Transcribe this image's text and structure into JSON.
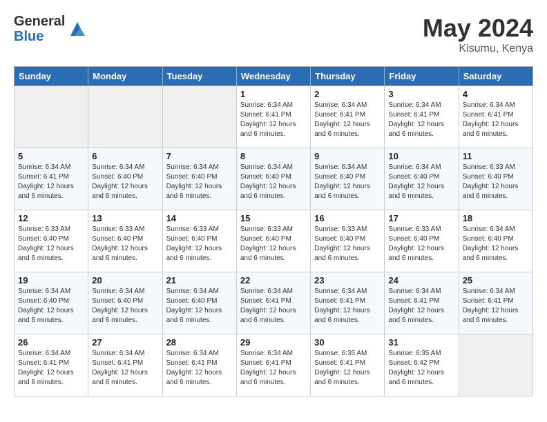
{
  "header": {
    "logo_general": "General",
    "logo_blue": "Blue",
    "month_title": "May 2024",
    "location": "Kisumu, Kenya"
  },
  "days_of_week": [
    "Sunday",
    "Monday",
    "Tuesday",
    "Wednesday",
    "Thursday",
    "Friday",
    "Saturday"
  ],
  "weeks": [
    [
      {
        "day": "",
        "info": ""
      },
      {
        "day": "",
        "info": ""
      },
      {
        "day": "",
        "info": ""
      },
      {
        "day": "1",
        "info": "Sunrise: 6:34 AM\nSunset: 6:41 PM\nDaylight: 12 hours\nand 6 minutes."
      },
      {
        "day": "2",
        "info": "Sunrise: 6:34 AM\nSunset: 6:41 PM\nDaylight: 12 hours\nand 6 minutes."
      },
      {
        "day": "3",
        "info": "Sunrise: 6:34 AM\nSunset: 6:41 PM\nDaylight: 12 hours\nand 6 minutes."
      },
      {
        "day": "4",
        "info": "Sunrise: 6:34 AM\nSunset: 6:41 PM\nDaylight: 12 hours\nand 6 minutes."
      }
    ],
    [
      {
        "day": "5",
        "info": "Sunrise: 6:34 AM\nSunset: 6:41 PM\nDaylight: 12 hours\nand 6 minutes."
      },
      {
        "day": "6",
        "info": "Sunrise: 6:34 AM\nSunset: 6:40 PM\nDaylight: 12 hours\nand 6 minutes."
      },
      {
        "day": "7",
        "info": "Sunrise: 6:34 AM\nSunset: 6:40 PM\nDaylight: 12 hours\nand 6 minutes."
      },
      {
        "day": "8",
        "info": "Sunrise: 6:34 AM\nSunset: 6:40 PM\nDaylight: 12 hours\nand 6 minutes."
      },
      {
        "day": "9",
        "info": "Sunrise: 6:34 AM\nSunset: 6:40 PM\nDaylight: 12 hours\nand 6 minutes."
      },
      {
        "day": "10",
        "info": "Sunrise: 6:34 AM\nSunset: 6:40 PM\nDaylight: 12 hours\nand 6 minutes."
      },
      {
        "day": "11",
        "info": "Sunrise: 6:33 AM\nSunset: 6:40 PM\nDaylight: 12 hours\nand 6 minutes."
      }
    ],
    [
      {
        "day": "12",
        "info": "Sunrise: 6:33 AM\nSunset: 6:40 PM\nDaylight: 12 hours\nand 6 minutes."
      },
      {
        "day": "13",
        "info": "Sunrise: 6:33 AM\nSunset: 6:40 PM\nDaylight: 12 hours\nand 6 minutes."
      },
      {
        "day": "14",
        "info": "Sunrise: 6:33 AM\nSunset: 6:40 PM\nDaylight: 12 hours\nand 6 minutes."
      },
      {
        "day": "15",
        "info": "Sunrise: 6:33 AM\nSunset: 6:40 PM\nDaylight: 12 hours\nand 6 minutes."
      },
      {
        "day": "16",
        "info": "Sunrise: 6:33 AM\nSunset: 6:40 PM\nDaylight: 12 hours\nand 6 minutes."
      },
      {
        "day": "17",
        "info": "Sunrise: 6:33 AM\nSunset: 6:40 PM\nDaylight: 12 hours\nand 6 minutes."
      },
      {
        "day": "18",
        "info": "Sunrise: 6:34 AM\nSunset: 6:40 PM\nDaylight: 12 hours\nand 6 minutes."
      }
    ],
    [
      {
        "day": "19",
        "info": "Sunrise: 6:34 AM\nSunset: 6:40 PM\nDaylight: 12 hours\nand 6 minutes."
      },
      {
        "day": "20",
        "info": "Sunrise: 6:34 AM\nSunset: 6:40 PM\nDaylight: 12 hours\nand 6 minutes."
      },
      {
        "day": "21",
        "info": "Sunrise: 6:34 AM\nSunset: 6:40 PM\nDaylight: 12 hours\nand 6 minutes."
      },
      {
        "day": "22",
        "info": "Sunrise: 6:34 AM\nSunset: 6:41 PM\nDaylight: 12 hours\nand 6 minutes."
      },
      {
        "day": "23",
        "info": "Sunrise: 6:34 AM\nSunset: 6:41 PM\nDaylight: 12 hours\nand 6 minutes."
      },
      {
        "day": "24",
        "info": "Sunrise: 6:34 AM\nSunset: 6:41 PM\nDaylight: 12 hours\nand 6 minutes."
      },
      {
        "day": "25",
        "info": "Sunrise: 6:34 AM\nSunset: 6:41 PM\nDaylight: 12 hours\nand 6 minutes."
      }
    ],
    [
      {
        "day": "26",
        "info": "Sunrise: 6:34 AM\nSunset: 6:41 PM\nDaylight: 12 hours\nand 6 minutes."
      },
      {
        "day": "27",
        "info": "Sunrise: 6:34 AM\nSunset: 6:41 PM\nDaylight: 12 hours\nand 6 minutes."
      },
      {
        "day": "28",
        "info": "Sunrise: 6:34 AM\nSunset: 6:41 PM\nDaylight: 12 hours\nand 6 minutes."
      },
      {
        "day": "29",
        "info": "Sunrise: 6:34 AM\nSunset: 6:41 PM\nDaylight: 12 hours\nand 6 minutes."
      },
      {
        "day": "30",
        "info": "Sunrise: 6:35 AM\nSunset: 6:41 PM\nDaylight: 12 hours\nand 6 minutes."
      },
      {
        "day": "31",
        "info": "Sunrise: 6:35 AM\nSunset: 6:42 PM\nDaylight: 12 hours\nand 6 minutes."
      },
      {
        "day": "",
        "info": ""
      }
    ]
  ]
}
